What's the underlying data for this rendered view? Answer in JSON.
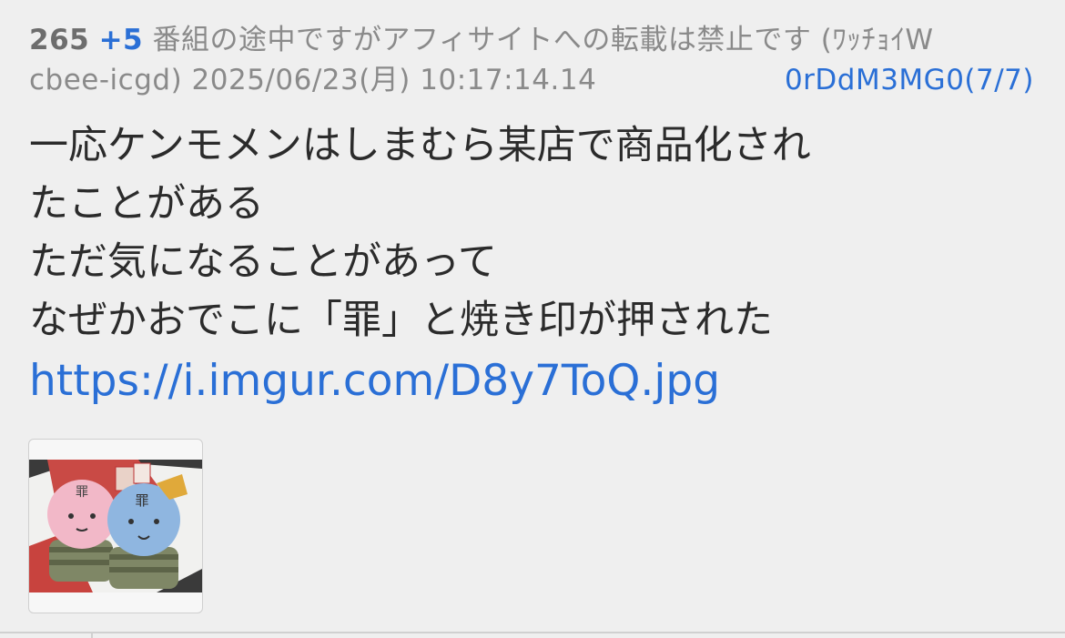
{
  "post": {
    "number": "265",
    "reply_count": "+5",
    "thread_title": "番組の途中ですがアフィサイトへの転載は禁止です",
    "name_part1": "(ﾜｯﾁｮｲW",
    "name_part2": "cbee-icgd)",
    "date": "2025/06/23(月)",
    "time": "10:17:14.14",
    "id": "0rDdM3MG0(7/7)",
    "body_lines": [
      "一応ケンモメンはしまむら某店で商品化され",
      "たことがある",
      "ただ気になることがあって",
      "なぜかおでこに「罪」と焼き印が押された"
    ],
    "link": "https://i.imgur.com/D8y7ToQ.jpg"
  },
  "thumbnail": {
    "icon": "image-thumbnail",
    "faces": [
      "罪",
      "罪"
    ]
  },
  "colors": {
    "background": "#efefef",
    "link": "#2a6fd6",
    "meta": "#8a8a8a",
    "text": "#2b2b2b"
  }
}
